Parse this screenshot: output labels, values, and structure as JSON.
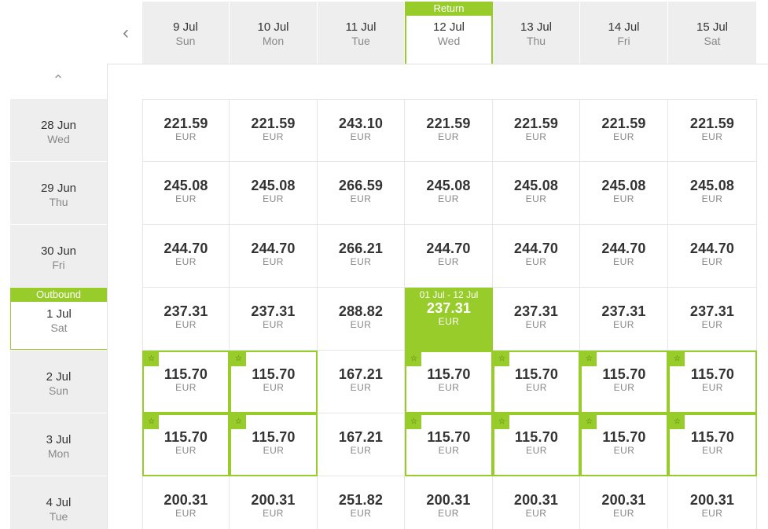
{
  "nav": {
    "prev_icon": "chevron-left-icon",
    "up_icon": "chevron-up-icon"
  },
  "return_tag": "Return",
  "outbound_tag": "Outbound",
  "columns": [
    {
      "date": "9 Jul",
      "day": "Sun"
    },
    {
      "date": "10 Jul",
      "day": "Mon"
    },
    {
      "date": "11 Jul",
      "day": "Tue"
    },
    {
      "date": "12 Jul",
      "day": "Wed"
    },
    {
      "date": "13 Jul",
      "day": "Thu"
    },
    {
      "date": "14 Jul",
      "day": "Fri"
    },
    {
      "date": "15 Jul",
      "day": "Sat"
    }
  ],
  "rows": [
    {
      "date": "28 Jun",
      "day": "Wed"
    },
    {
      "date": "29 Jun",
      "day": "Thu"
    },
    {
      "date": "30 Jun",
      "day": "Fri"
    },
    {
      "date": "1 Jul",
      "day": "Sat"
    },
    {
      "date": "2 Jul",
      "day": "Sun"
    },
    {
      "date": "3 Jul",
      "day": "Mon"
    },
    {
      "date": "4 Jul",
      "day": "Tue"
    }
  ],
  "currency": "EUR",
  "selected_range": "01 Jul - 12 Jul",
  "prices": [
    [
      "221.59",
      "221.59",
      "243.10",
      "221.59",
      "221.59",
      "221.59",
      "221.59"
    ],
    [
      "245.08",
      "245.08",
      "266.59",
      "245.08",
      "245.08",
      "245.08",
      "245.08"
    ],
    [
      "244.70",
      "244.70",
      "266.21",
      "244.70",
      "244.70",
      "244.70",
      "244.70"
    ],
    [
      "237.31",
      "237.31",
      "288.82",
      "237.31",
      "237.31",
      "237.31",
      "237.31"
    ],
    [
      "115.70",
      "115.70",
      "167.21",
      "115.70",
      "115.70",
      "115.70",
      "115.70"
    ],
    [
      "115.70",
      "115.70",
      "167.21",
      "115.70",
      "115.70",
      "115.70",
      "115.70"
    ],
    [
      "200.31",
      "200.31",
      "251.82",
      "200.31",
      "200.31",
      "200.31",
      "200.31"
    ]
  ],
  "cheapest_marker": "star-icon",
  "cheap_cells": [
    [
      false,
      false,
      false,
      false,
      false,
      false,
      false
    ],
    [
      false,
      false,
      false,
      false,
      false,
      false,
      false
    ],
    [
      false,
      false,
      false,
      false,
      false,
      false,
      false
    ],
    [
      false,
      false,
      false,
      false,
      false,
      false,
      false
    ],
    [
      true,
      true,
      false,
      true,
      true,
      true,
      true
    ],
    [
      true,
      true,
      false,
      true,
      true,
      true,
      true
    ],
    [
      false,
      false,
      false,
      false,
      false,
      false,
      false
    ]
  ],
  "selected": {
    "row": 3,
    "col": 3
  },
  "colors": {
    "accent": "#97cc2b",
    "header_bg": "#eeeeee"
  }
}
